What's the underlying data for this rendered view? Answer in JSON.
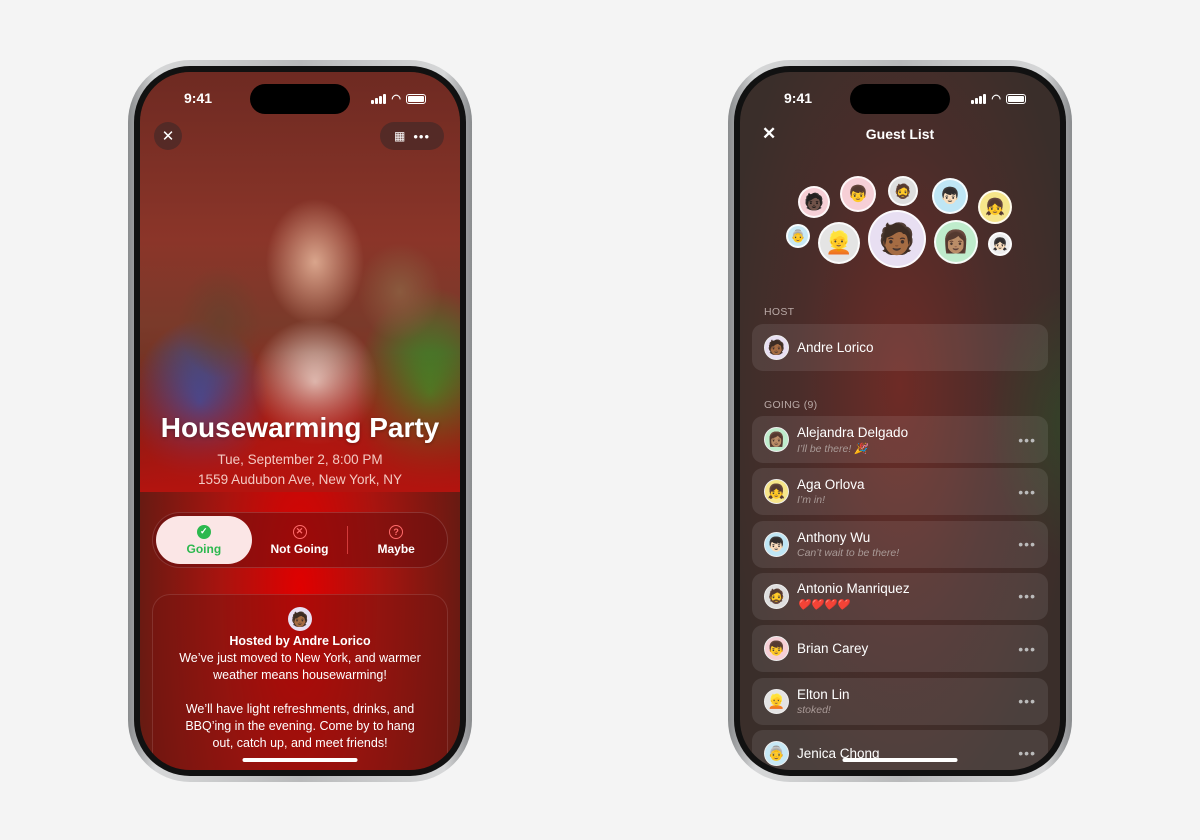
{
  "status_bar": {
    "time": "9:41"
  },
  "event": {
    "title": "Housewarming Party",
    "datetime": "Tue, September 2, 8:00 PM",
    "address": "1559 Audubon Ave, New York, NY",
    "rsvp": [
      {
        "label": "Going",
        "icon": "checkmark-circle",
        "selected": true
      },
      {
        "label": "Not Going",
        "icon": "x-circle"
      },
      {
        "label": "Maybe",
        "icon": "question-circle"
      }
    ],
    "host_line": "Hosted by Andre Lorico",
    "description_p1": "We’ve just moved to New York, and warmer weather means housewarming!",
    "description_p2": "We’ll have light refreshments, drinks, and BBQ’ing in the evening. Come by to hang out, catch up, and meet friends!",
    "accent_going": "#2cb84e"
  },
  "guest_list": {
    "title": "Guest List",
    "host_header": "HOST",
    "host": {
      "name": "Andre Lorico"
    },
    "going_header": "GOING (9)",
    "guests": [
      {
        "name": "Alejandra Delgado",
        "message": "I’ll be there! 🎉",
        "color": "#bfeccc"
      },
      {
        "name": "Aga Orlova",
        "message": "I’m in!",
        "color": "#f6e58a"
      },
      {
        "name": "Anthony Wu",
        "message": "Can’t wait to be there!",
        "color": "#bfe6f5"
      },
      {
        "name": "Antonio Manriquez",
        "message": "❤️❤️❤️❤️",
        "color": "#dedede"
      },
      {
        "name": "Brian Carey",
        "message": "",
        "color": "#f6cfd6"
      },
      {
        "name": "Elton Lin",
        "message": "stoked!",
        "color": "#e4e4e4"
      },
      {
        "name": "Jenica Chong",
        "message": "",
        "color": "#c7e8f5"
      }
    ]
  }
}
